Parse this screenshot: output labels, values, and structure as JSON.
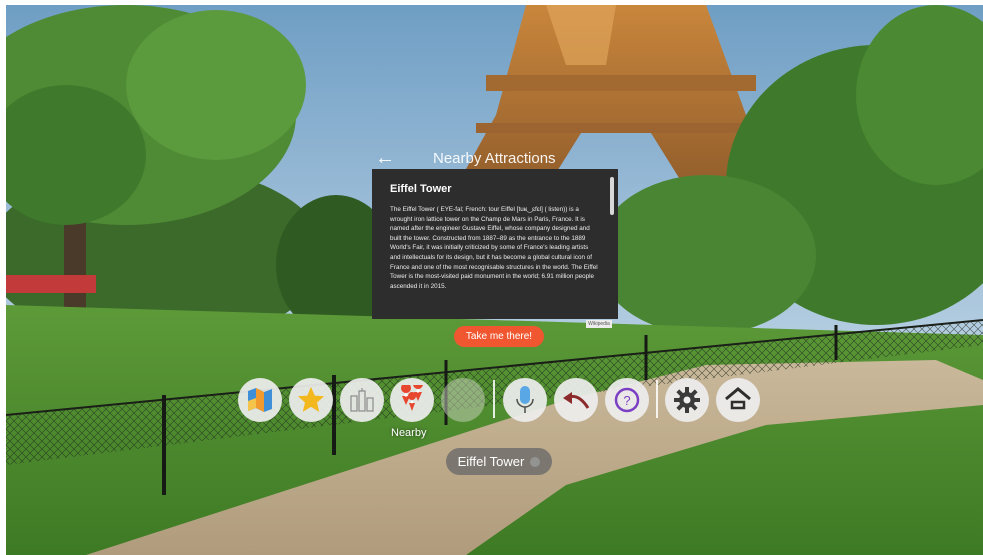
{
  "header": {
    "back_icon": "←",
    "title": "Nearby Attractions"
  },
  "info_panel": {
    "title": "Eiffel Tower",
    "body": "The Eiffel Tower ( EYE-fal; French: tour Eiffel [tuʁ‿ɛfɛl] ( listen)) is a wrought iron lattice tower on the Champ de Mars in Paris, France. It is named after the engineer Gustave Eiffel, whose company designed and built the tower. Constructed from 1887–89 as the entrance to the 1889 World's Fair, it was initially criticized by some of France's leading artists and intellectuals for its design, but it has become a global cultural icon of France and one of the most recognisable structures in the world. The Eiffel Tower is the most-visited paid monument in the world; 6.91 million people ascended it in 2015.",
    "source_badge": "Wikipedia"
  },
  "cta": {
    "label": "Take me there!"
  },
  "toolbar": {
    "items": [
      {
        "name": "map-icon"
      },
      {
        "name": "star-icon"
      },
      {
        "name": "landmarks-icon"
      },
      {
        "name": "nearby-icon",
        "label": "Nearby"
      },
      {
        "name": "blank-icon"
      },
      {
        "name": "microphone-icon"
      },
      {
        "name": "back-curve-icon"
      },
      {
        "name": "help-icon"
      },
      {
        "name": "gear-icon"
      },
      {
        "name": "home-icon"
      }
    ]
  },
  "location": {
    "label": "Eiffel Tower"
  },
  "colors": {
    "accent": "#f0562f",
    "panel": "#2d2d2d"
  }
}
